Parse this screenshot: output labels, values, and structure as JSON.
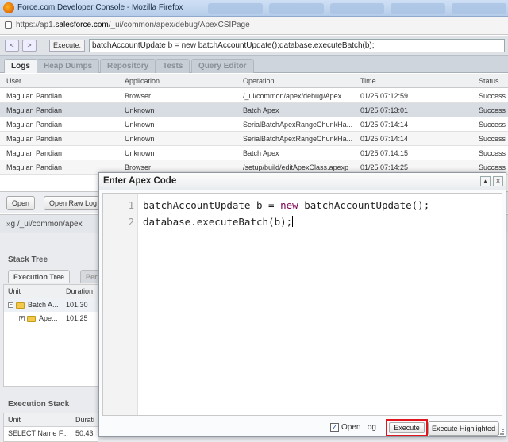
{
  "window": {
    "title": "Force.com Developer Console - Mozilla Firefox"
  },
  "address": {
    "prefix": "https://ap1.",
    "domain": "salesforce.com",
    "path": "/_ui/common/apex/debug/ApexCSIPage"
  },
  "nav": {
    "back": "<",
    "forward": ">"
  },
  "execute_bar": {
    "label": "Execute:",
    "value": "batchAccountUpdate b = new batchAccountUpdate();database.executeBatch(b);"
  },
  "tabs": [
    {
      "label": "Logs"
    },
    {
      "label": "Heap Dumps"
    },
    {
      "label": "Repository"
    },
    {
      "label": "Tests"
    },
    {
      "label": "Query Editor"
    }
  ],
  "logs": {
    "columns": [
      "User",
      "Application",
      "Operation",
      "Time",
      "Status"
    ],
    "rows": [
      [
        "Magulan Pandian",
        "Browser",
        "/_ui/common/apex/debug/Apex...",
        "01/25 07:12:59",
        "Success"
      ],
      [
        "Magulan Pandian",
        "Unknown",
        "Batch Apex",
        "01/25 07:13:01",
        "Success"
      ],
      [
        "Magulan Pandian",
        "Unknown",
        "SerialBatchApexRangeChunkHa...",
        "01/25 07:14:14",
        "Success"
      ],
      [
        "Magulan Pandian",
        "Unknown",
        "SerialBatchApexRangeChunkHa...",
        "01/25 07:14:14",
        "Success"
      ],
      [
        "Magulan Pandian",
        "Unknown",
        "Batch Apex",
        "01/25 07:14:15",
        "Success"
      ],
      [
        "Magulan Pandian",
        "Browser",
        "/setup/build/editApexClass.apexp",
        "01/25 07:14:25",
        "Success"
      ]
    ]
  },
  "log_buttons": {
    "open": "Open",
    "open_raw": "Open Raw Log"
  },
  "path": {
    "text": "»g /_ui/common/apex"
  },
  "stack_tree": {
    "title": "Stack Tree",
    "tabs": [
      "Execution Tree",
      "Per"
    ],
    "columns": [
      "Unit",
      "Duration"
    ],
    "rows": [
      {
        "unit": "Batch A...",
        "duration": "101.30",
        "expander": "−"
      },
      {
        "unit": "Ape...",
        "duration": "101.25",
        "expander": "+"
      }
    ]
  },
  "execution_stack": {
    "title": "Execution Stack",
    "columns": [
      "Unit",
      "Durati"
    ],
    "rows": [
      {
        "unit": "SELECT Name F...",
        "duration": "50.43"
      }
    ]
  },
  "modal": {
    "title": "Enter Apex Code",
    "maximize": "▴",
    "close": "×",
    "code": [
      {
        "line": "1",
        "pre": "batchAccountUpdate b = ",
        "kw": "new",
        "post": " batchAccountUpdate();"
      },
      {
        "line": "2",
        "pre": "database.executeBatch(b);",
        "kw": "",
        "post": ""
      }
    ],
    "open_log_label": "Open Log",
    "open_log_checked": "✓",
    "execute": "Execute",
    "execute_highlighted": "Execute Highlighted"
  },
  "colors": {
    "highlight_border": "#e0151e",
    "keyword": "#7f0055",
    "selected_row": "#d8dde4"
  }
}
